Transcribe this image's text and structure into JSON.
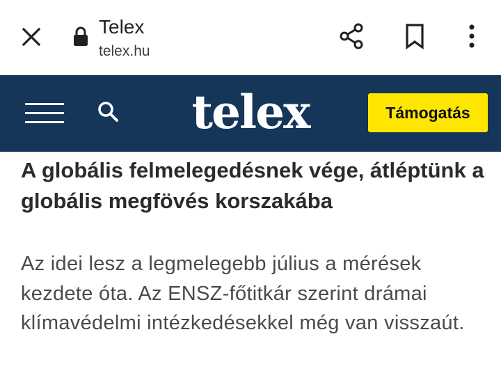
{
  "browser": {
    "title": "Telex",
    "url": "telex.hu",
    "icons": [
      "close-icon",
      "lock-icon",
      "share-icon",
      "bookmark-icon",
      "more-vert-icon"
    ]
  },
  "site_header": {
    "logo_text": "telex",
    "support_label": "Támogatás",
    "icons": [
      "hamburger-menu-icon",
      "search-icon"
    ],
    "colors": {
      "header_bg": "#153559",
      "support_bg": "#ffe600"
    }
  },
  "article": {
    "headline": "A globális felmelegedésnek vége, átléptünk a globális megfövés korszakába",
    "lead": "Az idei lesz a legmelegebb július a mérések kezdete óta. Az ENSZ-főtitkár szerint drámai klímavédelmi intézkedésekkel még van visszaút."
  }
}
